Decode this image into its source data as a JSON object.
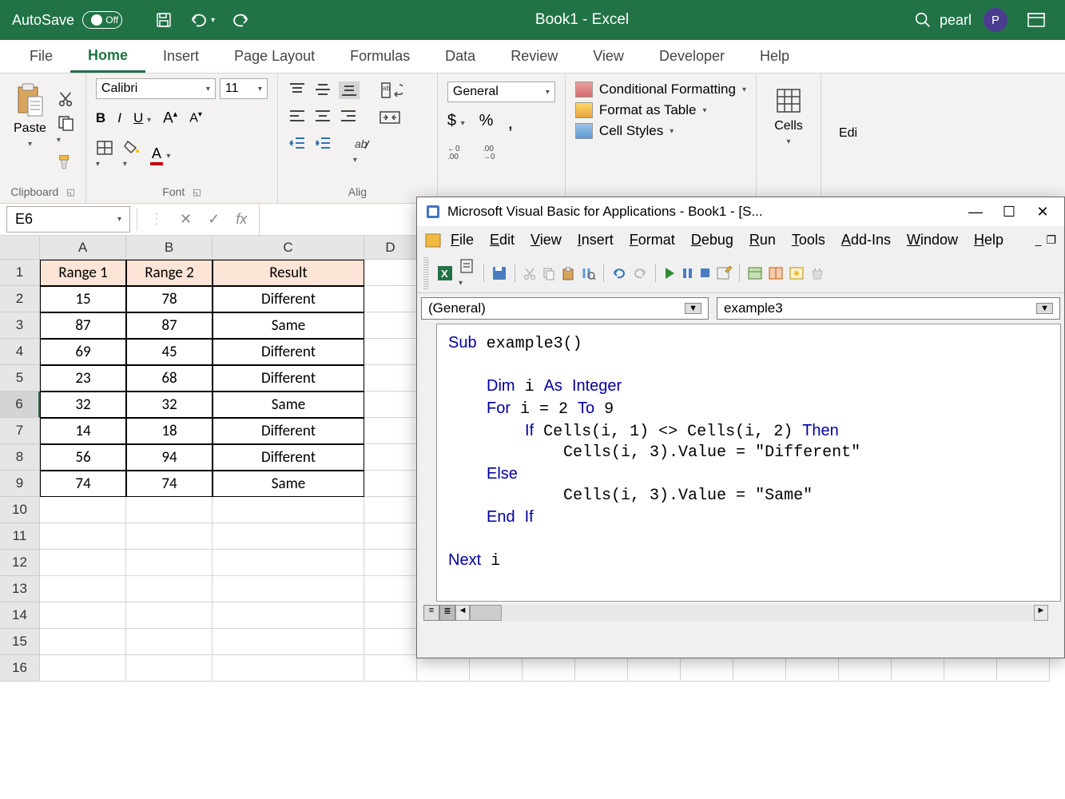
{
  "titlebar": {
    "autosave_label": "AutoSave",
    "autosave_state": "Off",
    "title": "Book1 - Excel",
    "user_name": "pearl",
    "user_initial": "P"
  },
  "tabs": [
    "File",
    "Home",
    "Insert",
    "Page Layout",
    "Formulas",
    "Data",
    "Review",
    "View",
    "Developer",
    "Help"
  ],
  "active_tab": "Home",
  "ribbon": {
    "clipboard": {
      "paste": "Paste",
      "label": "Clipboard"
    },
    "font": {
      "name": "Calibri",
      "size": "11",
      "B": "B",
      "I": "I",
      "label": "Font"
    },
    "alignment": {
      "label": "Alig"
    },
    "number": {
      "format": "General"
    },
    "styles": {
      "cond": "Conditional Formatting",
      "table": "Format as Table",
      "cell": "Cell Styles"
    },
    "cells": {
      "label": "Cells"
    },
    "editing": {
      "label": "Edi"
    }
  },
  "formula_bar": {
    "name_box": "E6",
    "fx": "fx"
  },
  "sheet": {
    "columns": [
      "A",
      "B",
      "C",
      "D"
    ],
    "headers": [
      "Range 1",
      "Range 2",
      "Result"
    ],
    "rows": [
      {
        "n": 1
      },
      {
        "n": 2,
        "a": "15",
        "b": "78",
        "c": "Different"
      },
      {
        "n": 3,
        "a": "87",
        "b": "87",
        "c": "Same"
      },
      {
        "n": 4,
        "a": "69",
        "b": "45",
        "c": "Different"
      },
      {
        "n": 5,
        "a": "23",
        "b": "68",
        "c": "Different"
      },
      {
        "n": 6,
        "a": "32",
        "b": "32",
        "c": "Same"
      },
      {
        "n": 7,
        "a": "14",
        "b": "18",
        "c": "Different"
      },
      {
        "n": 8,
        "a": "56",
        "b": "94",
        "c": "Different"
      },
      {
        "n": 9,
        "a": "74",
        "b": "74",
        "c": "Same"
      },
      {
        "n": 10
      },
      {
        "n": 11
      },
      {
        "n": 12
      },
      {
        "n": 13
      },
      {
        "n": 14
      },
      {
        "n": 15
      },
      {
        "n": 16
      }
    ],
    "selected_cell": "E6",
    "selected_row": 6
  },
  "vba": {
    "title": "Microsoft Visual Basic for Applications - Book1 - [S...",
    "menu": [
      "File",
      "Edit",
      "View",
      "Insert",
      "Format",
      "Debug",
      "Run",
      "Tools",
      "Add-Ins",
      "Window",
      "Help"
    ],
    "obj_dropdown": "(General)",
    "proc_dropdown": "example3",
    "code_lines": [
      {
        "t": "Sub example3()",
        "indent": 0,
        "kw": [
          "Sub"
        ]
      },
      {
        "t": "",
        "indent": 0
      },
      {
        "t": "Dim i As Integer",
        "indent": 1,
        "kw": [
          "Dim",
          "As",
          "Integer"
        ]
      },
      {
        "t": "For i = 2 To 9",
        "indent": 1,
        "kw": [
          "For",
          "To"
        ]
      },
      {
        "t": "If Cells(i, 1) <> Cells(i, 2) Then",
        "indent": 2,
        "kw": [
          "If",
          "Then"
        ]
      },
      {
        "t": "Cells(i, 3).Value = \"Different\"",
        "indent": 3,
        "kw": []
      },
      {
        "t": "Else",
        "indent": 1,
        "kw": [
          "Else"
        ]
      },
      {
        "t": "Cells(i, 3).Value = \"Same\"",
        "indent": 3,
        "kw": []
      },
      {
        "t": "End If",
        "indent": 1,
        "kw": [
          "End",
          "If"
        ]
      },
      {
        "t": "",
        "indent": 0
      },
      {
        "t": "Next i",
        "indent": 0,
        "kw": [
          "Next"
        ]
      }
    ]
  }
}
